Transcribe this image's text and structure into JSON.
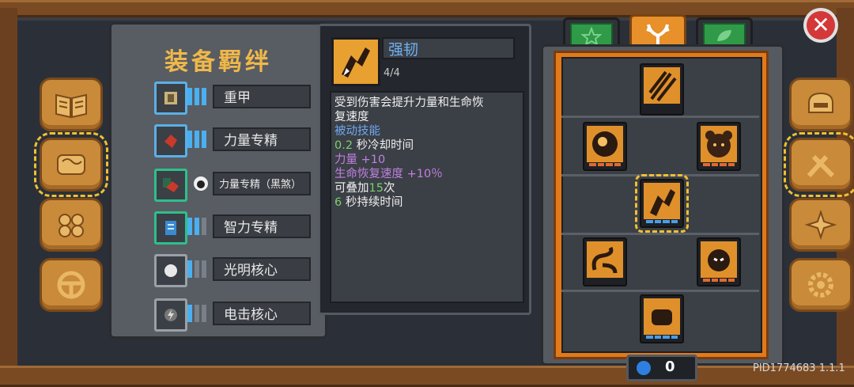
{
  "panel": {
    "title": "装备羁绊",
    "bonds": [
      {
        "label": "重甲"
      },
      {
        "label": "力量专精"
      },
      {
        "label": "力量专精（黑煞）"
      },
      {
        "label": "智力专精"
      },
      {
        "label": "光明核心"
      },
      {
        "label": "电击核心"
      }
    ]
  },
  "tooltip": {
    "name": "强韧",
    "count": "4/4",
    "desc_line1": "受到伤害会提升力量和生命恢",
    "desc_line2": "复速度",
    "type": "被动技能",
    "cooldown_num": "0.2",
    "cooldown_text": " 秒冷却时间",
    "strength": "力量 +10",
    "regen": "生命恢复速度 +10％",
    "stack_pre": "可叠加",
    "stack_num": "15",
    "stack_post": "次",
    "duration_num": "6",
    "duration_text": " 秒持续时间"
  },
  "skill_points": "0",
  "pid": "PID1774683 1.1.1",
  "icons": {
    "close": "close-icon",
    "tabs": [
      "star-icon",
      "antlers-icon",
      "leaf-icon"
    ],
    "left_nav": [
      "book-icon",
      "scroll-icon",
      "gears-icon",
      "wheel-icon"
    ],
    "right_nav": [
      "helmet-icon",
      "weapon-icon",
      "fairy-icon",
      "gear-icon"
    ]
  },
  "colors": {
    "accent": "#e8902a",
    "title": "#f0b84a",
    "close": "#d43838"
  }
}
